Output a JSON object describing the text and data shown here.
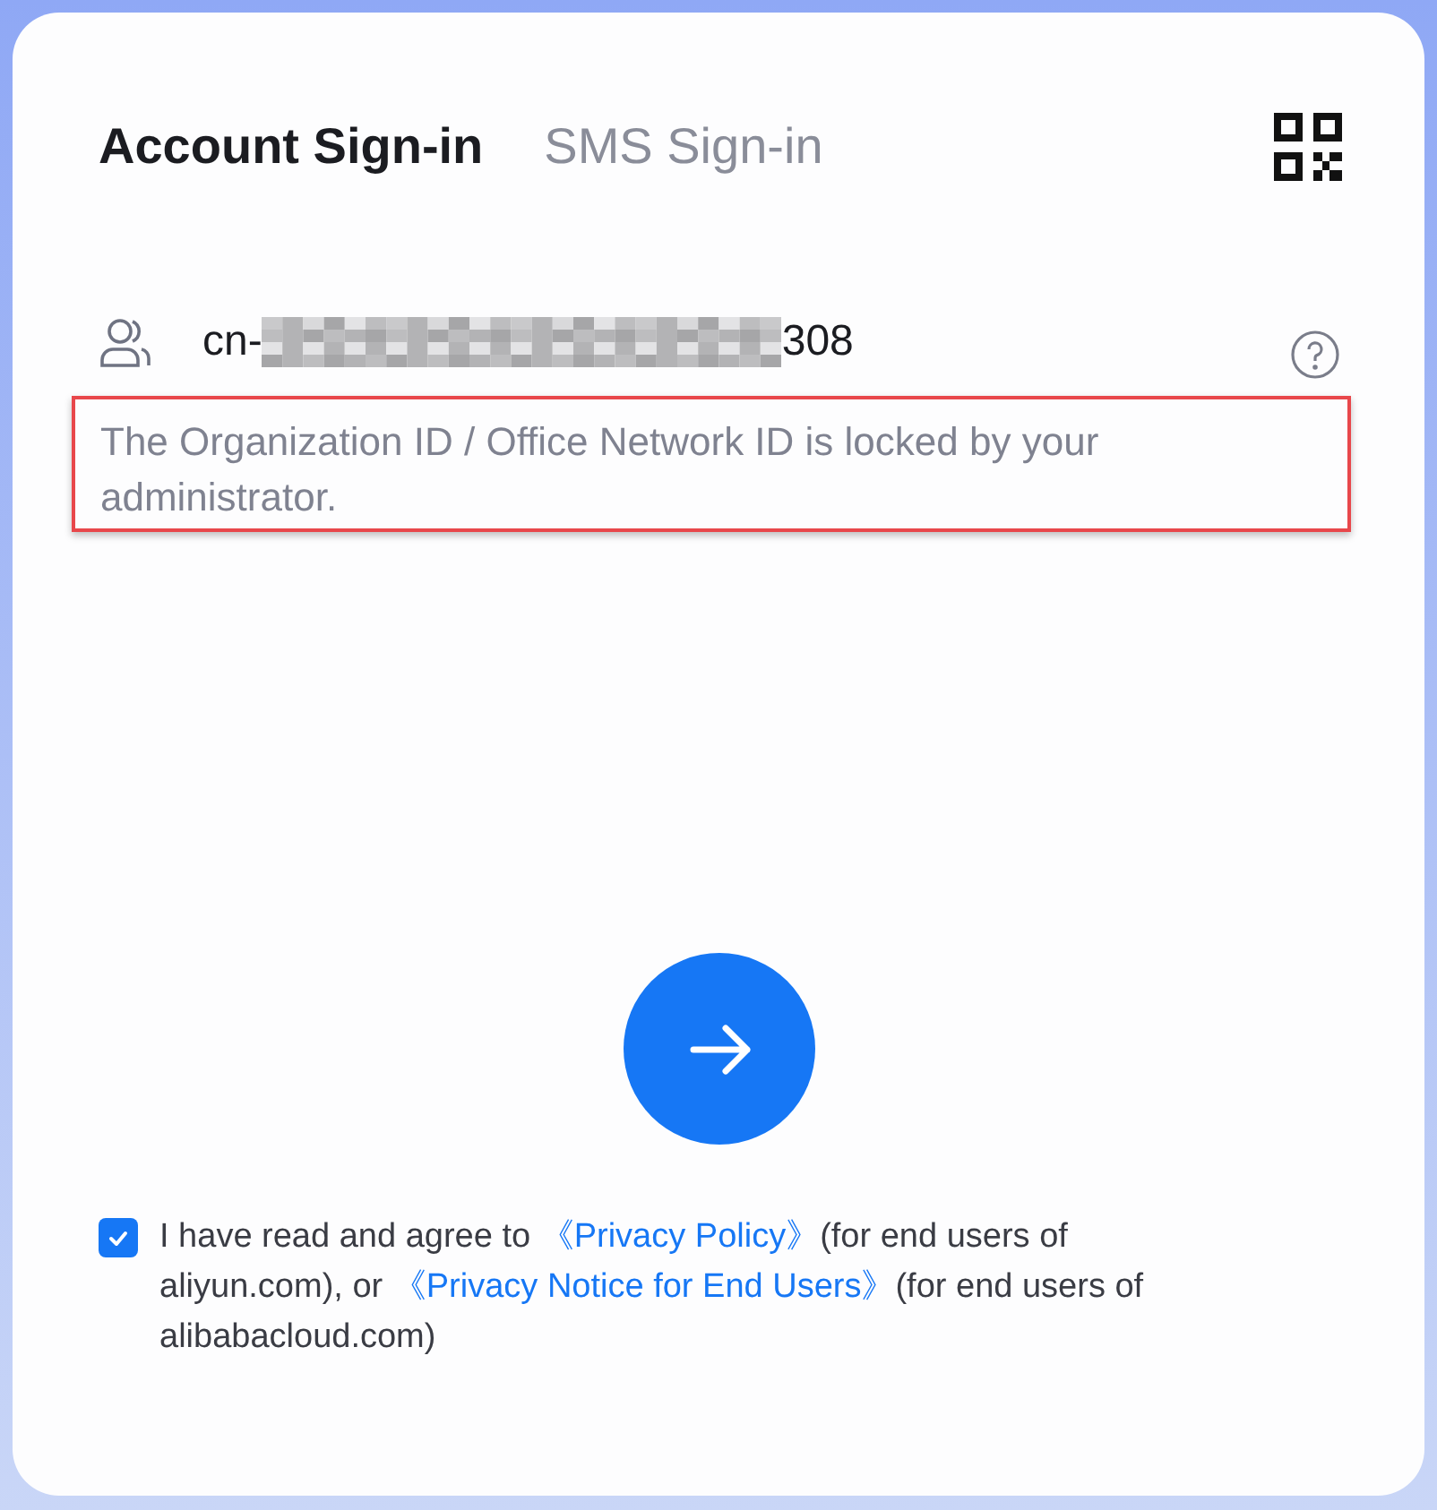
{
  "tabs": [
    {
      "label": "Account Sign-in",
      "selected": true
    },
    {
      "label": "SMS Sign-in",
      "selected": false
    }
  ],
  "account_field": {
    "value_start": "cn-",
    "value_end": "308"
  },
  "notice": "The Organization ID / Office Network ID is locked by your administrator.",
  "agreement": {
    "checked": true,
    "parts": [
      {
        "kind": "text",
        "text": "I have read and agree to "
      },
      {
        "kind": "link",
        "text": "《Privacy Policy》"
      },
      {
        "kind": "text",
        "text": "(for end users of aliyun.com), or "
      },
      {
        "kind": "link",
        "text": "《Privacy Notice for End Users》"
      },
      {
        "kind": "text",
        "text": "(for end users of alibabacloud.com)"
      }
    ]
  }
}
